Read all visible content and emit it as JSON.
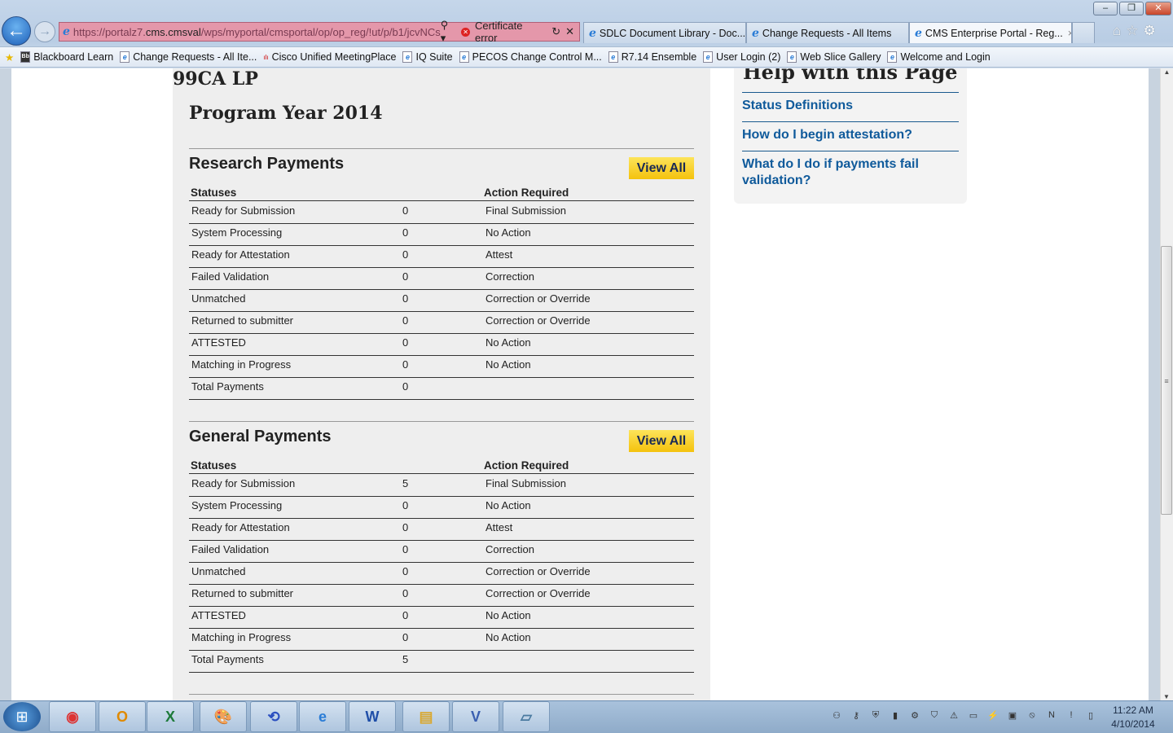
{
  "browser": {
    "address": {
      "prefix": "https://portalz7.",
      "host": "cms.cmsval",
      "path": "/wps/myportal/cmsportal/op/op_reg/!ut/p/b1/jcvNCs",
      "cert_error": "Certificate error"
    },
    "tabs": [
      {
        "label": "SDLC Document Library - Doc...",
        "active": false
      },
      {
        "label": "Change Requests - All Items",
        "active": false
      },
      {
        "label": "CMS Enterprise Portal - Reg...",
        "active": true
      }
    ],
    "bookmarks": [
      "Blackboard Learn",
      "Change Requests - All Ite...",
      "Cisco Unified MeetingPlace",
      "IQ Suite",
      "PECOS Change Control M...",
      "R7.14 Ensemble",
      "User Login (2)",
      "Web Slice Gallery",
      "Welcome and Login"
    ]
  },
  "page": {
    "org_name": "99CA LP",
    "program_year": "Program Year 2014",
    "columns": {
      "status": "Statuses",
      "action": "Action Required"
    },
    "view_all_label": "View All",
    "sections": [
      {
        "title": "Research Payments",
        "rows": [
          {
            "status": "Ready for Submission",
            "count": "0",
            "action": "Final Submission"
          },
          {
            "status": "System Processing",
            "count": "0",
            "action": "No Action"
          },
          {
            "status": "Ready for Attestation",
            "count": "0",
            "action": "Attest"
          },
          {
            "status": "Failed Validation",
            "count": "0",
            "action": "Correction"
          },
          {
            "status": "Unmatched",
            "count": "0",
            "action": "Correction or Override"
          },
          {
            "status": "Returned to submitter",
            "count": "0",
            "action": "Correction or Override"
          },
          {
            "status": "ATTESTED",
            "count": "0",
            "action": "No Action"
          },
          {
            "status": "Matching in Progress",
            "count": "0",
            "action": "No Action"
          },
          {
            "status": "Total Payments",
            "count": "0",
            "action": ""
          }
        ]
      },
      {
        "title": "General Payments",
        "rows": [
          {
            "status": "Ready for Submission",
            "count": "5",
            "action": "Final Submission"
          },
          {
            "status": "System Processing",
            "count": "0",
            "action": "No Action"
          },
          {
            "status": "Ready for Attestation",
            "count": "0",
            "action": "Attest"
          },
          {
            "status": "Failed Validation",
            "count": "0",
            "action": "Correction"
          },
          {
            "status": "Unmatched",
            "count": "0",
            "action": "Correction or Override"
          },
          {
            "status": "Returned to submitter",
            "count": "0",
            "action": "Correction or Override"
          },
          {
            "status": "ATTESTED",
            "count": "0",
            "action": "No Action"
          },
          {
            "status": "Matching in Progress",
            "count": "0",
            "action": "No Action"
          },
          {
            "status": "Total Payments",
            "count": "5",
            "action": ""
          }
        ]
      }
    ],
    "help": {
      "title": "Help with this Page",
      "links": [
        "Status Definitions",
        "How do I begin attestation?",
        "What do I do if payments fail validation?"
      ]
    }
  },
  "taskbar": {
    "apps": [
      "chrome",
      "outlook",
      "excel",
      "paint",
      "app-blue",
      "internet-explorer",
      "word",
      "file-explorer",
      "visio",
      "notepad"
    ],
    "time": "11:22 AM",
    "date": "4/10/2014"
  },
  "colors": {
    "view_all": "#f4c20d",
    "link": "#0f5a9b",
    "address_error": "#e497aa"
  }
}
